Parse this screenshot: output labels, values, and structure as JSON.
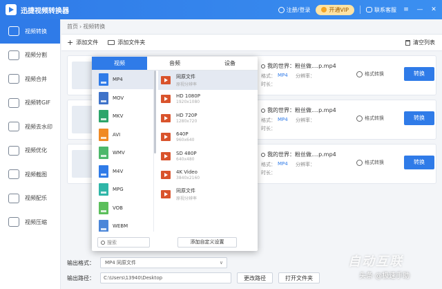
{
  "app": {
    "title": "迅捷视频转换器",
    "login": "注册/登录",
    "vip": "开通VIP",
    "contact": "联系客服"
  },
  "sidebar": {
    "items": [
      {
        "label": "视频转换",
        "icon": "video-convert-icon"
      },
      {
        "label": "视频分割",
        "icon": "video-split-icon"
      },
      {
        "label": "视频合并",
        "icon": "video-merge-icon"
      },
      {
        "label": "视频转GIF",
        "icon": "video-gif-icon"
      },
      {
        "label": "视频去水印",
        "icon": "watermark-remove-icon"
      },
      {
        "label": "视频优化",
        "icon": "video-optimize-icon"
      },
      {
        "label": "视频截图",
        "icon": "screenshot-icon"
      },
      {
        "label": "视频配乐",
        "icon": "music-icon"
      },
      {
        "label": "视频压缩",
        "icon": "compress-icon"
      }
    ]
  },
  "breadcrumb": {
    "home": "首页",
    "sep": "›",
    "current": "视频转换"
  },
  "toolbar": {
    "add_file": "添加文件",
    "add_folder": "添加文件夹",
    "clear": "清空列表"
  },
  "files": [
    {
      "name": "我的世界：粉丝做....p.mp4",
      "format_label": "格式：",
      "format": "MP4",
      "res_label": "分辨率：",
      "extra": "时长：",
      "settings": "格式转换",
      "convert": "转换"
    },
    {
      "name": "我的世界：粉丝做....p.mp4",
      "format_label": "格式：",
      "format": "MP4",
      "res_label": "分辨率：",
      "extra": "时长：",
      "settings": "格式转换",
      "convert": "转换"
    },
    {
      "name": "我的世界：粉丝做....p.mp4",
      "format_label": "格式：",
      "format": "MP4",
      "res_label": "分辨率：",
      "extra": "时长：",
      "settings": "格式转换",
      "convert": "转换"
    }
  ],
  "bottom": {
    "output_format_label": "输出格式：",
    "output_format_value": "MP4  同原文件",
    "output_path_label": "输出路径：",
    "output_path_value": "C:\\Users\\13940\\Desktop",
    "change_path": "更改路径",
    "open_folder": "打开文件夹"
  },
  "popup": {
    "tabs": [
      "视频",
      "音频",
      "设备"
    ],
    "formats": [
      {
        "name": "MP4",
        "color": "#2f7be8"
      },
      {
        "name": "MOV",
        "color": "#3f73c9"
      },
      {
        "name": "MKV",
        "color": "#2ca56a"
      },
      {
        "name": "AVI",
        "color": "#f08a24"
      },
      {
        "name": "WMV",
        "color": "#4db86a"
      },
      {
        "name": "M4V",
        "color": "#2f7be8"
      },
      {
        "name": "MPG",
        "color": "#2fb6a8"
      },
      {
        "name": "VOB",
        "color": "#5bbf5b"
      },
      {
        "name": "WEBM",
        "color": "#4a86d9"
      }
    ],
    "qualities": [
      {
        "title": "同原文件",
        "sub": "原视分辨率"
      },
      {
        "title": "HD 1080P",
        "sub": "1920x1080"
      },
      {
        "title": "HD 720P",
        "sub": "1280x720"
      },
      {
        "title": "640P",
        "sub": "960x640"
      },
      {
        "title": "SD 480P",
        "sub": "640x480"
      },
      {
        "title": "4K Video",
        "sub": "3840x2160"
      },
      {
        "title": "同原文件",
        "sub": "原视分辨率"
      }
    ],
    "search_placeholder": "搜索",
    "custom": "添加自定义设置"
  },
  "watermark": {
    "logo": "自动互联",
    "text": "头条 @极速手助"
  }
}
